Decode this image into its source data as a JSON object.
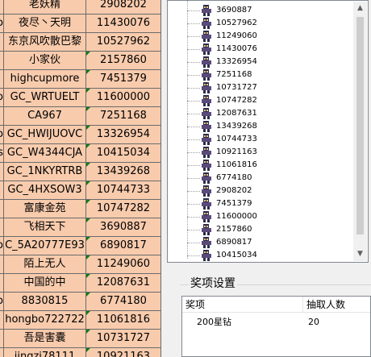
{
  "sheet": {
    "rows": [
      {
        "prefix": "",
        "name": "老妖精",
        "id": "2908202",
        "flag": true
      },
      {
        "prefix": "o",
        "name": "夜尽丶天明",
        "id": "11430076",
        "flag": false
      },
      {
        "prefix": "",
        "name": "东京风吹散巴黎",
        "id": "10527962",
        "flag": false
      },
      {
        "prefix": "",
        "name": "小家伙",
        "id": "2157860",
        "flag": true
      },
      {
        "prefix": "",
        "name": "highcupmore",
        "id": "7451379",
        "flag": true
      },
      {
        "prefix": "o",
        "name": "GC_WRTUELT",
        "id": "11600000",
        "flag": true
      },
      {
        "prefix": "",
        "name": "CA967",
        "id": "7251168",
        "flag": true
      },
      {
        "prefix": "o",
        "name": "GC_HWIJUOVC",
        "id": "13326954",
        "flag": true
      },
      {
        "prefix": "s",
        "name": "GC_W4344CJA",
        "id": "10415034",
        "flag": true
      },
      {
        "prefix": "",
        "name": "GC_1NKYRTRB",
        "id": "13439268",
        "flag": true
      },
      {
        "prefix": "",
        "name": "GC_4HXSOW3",
        "id": "10744733",
        "flag": true
      },
      {
        "prefix": "",
        "name": "富康金苑",
        "id": "10747282",
        "flag": true
      },
      {
        "prefix": "",
        "name": "飞相天下",
        "id": "3690887",
        "flag": true
      },
      {
        "prefix": "o",
        "name": "C_5A20777E93",
        "id": "6890817",
        "flag": true
      },
      {
        "prefix": "",
        "name": "陌上无人",
        "id": "11249060",
        "flag": true
      },
      {
        "prefix": "",
        "name": "中国的中",
        "id": "12087631",
        "flag": true
      },
      {
        "prefix": "o",
        "name": "8830815",
        "id": "6774180",
        "flag": true
      },
      {
        "prefix": "",
        "name": "hongbo722722",
        "id": "11061816",
        "flag": true
      },
      {
        "prefix": "",
        "name": "吾是害囊",
        "id": "10731727",
        "flag": true
      },
      {
        "prefix": "",
        "name": "jingzi78111",
        "id": "10921163",
        "flag": true
      }
    ]
  },
  "list": {
    "items": [
      "3690887",
      "10527962",
      "11249060",
      "11430076",
      "13326954",
      "7251168",
      "10731727",
      "10747282",
      "12087631",
      "13439268",
      "10744733",
      "10921163",
      "11061816",
      "6774180",
      "2908202",
      "7451379",
      "11600000",
      "2157860",
      "6890817",
      "10415034"
    ]
  },
  "prize": {
    "group_title": "奖项设置",
    "col_prize": "奖项",
    "col_count": "抽取人数",
    "rows": [
      {
        "prize": "200星钻",
        "count": "20"
      }
    ]
  },
  "colors": {
    "cell_fill": "#f8cbad",
    "flag": "#107c10",
    "grid": "#6b6b6b"
  }
}
